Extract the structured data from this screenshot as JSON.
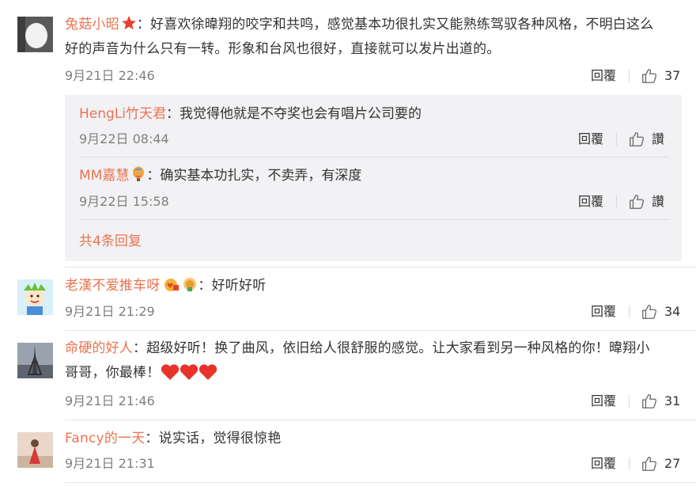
{
  "comments": [
    {
      "user": "兔菇小昭",
      "badge": "star-badge-icon",
      "line1": "：好喜欢徐暐翔的咬字和共鸣，感觉基本功很扎实又能熟练驾驭各种风格，不明白这么",
      "line2": "好的声音为什么只有一转。形象和台风也很好，直接就可以发片出道的。",
      "date": "9月21日 22:46",
      "reply_label": "回覆",
      "likes": "37"
    },
    {
      "user": "老漢不爱推车呀",
      "text": "：好听好听",
      "date": "9月21日 21:29",
      "reply_label": "回覆",
      "likes": "34"
    },
    {
      "user": "命硬的好人",
      "line1": "：超级好听！换了曲风，依旧给人很舒服的感觉。让大家看到另一种风格的你！暐翔小",
      "line2": "哥哥，你最棒！",
      "date": "9月21日 21:46",
      "reply_label": "回覆",
      "likes": "31"
    },
    {
      "user": "Fancy的一天",
      "text": "：说实话，觉得很惊艳",
      "date": "9月21日 21:31",
      "reply_label": "回覆",
      "likes": "27"
    }
  ],
  "sub_replies": [
    {
      "user": "HengLi竹天君",
      "text": "：我觉得他就是不夺奖也会有唱片公司要的",
      "date": "9月22日 08:44",
      "reply_label": "回覆",
      "like_label": "讚"
    },
    {
      "user": "MM嘉慧",
      "text": "：确实基本功扎实，不卖弄，有深度",
      "date": "9月22日 15:58",
      "reply_label": "回覆",
      "like_label": "讚"
    }
  ],
  "more_replies_label": "共4条回复",
  "colors": {
    "username": "#eb7350",
    "date": "#808080",
    "sub_background": "#f2f2f5"
  }
}
